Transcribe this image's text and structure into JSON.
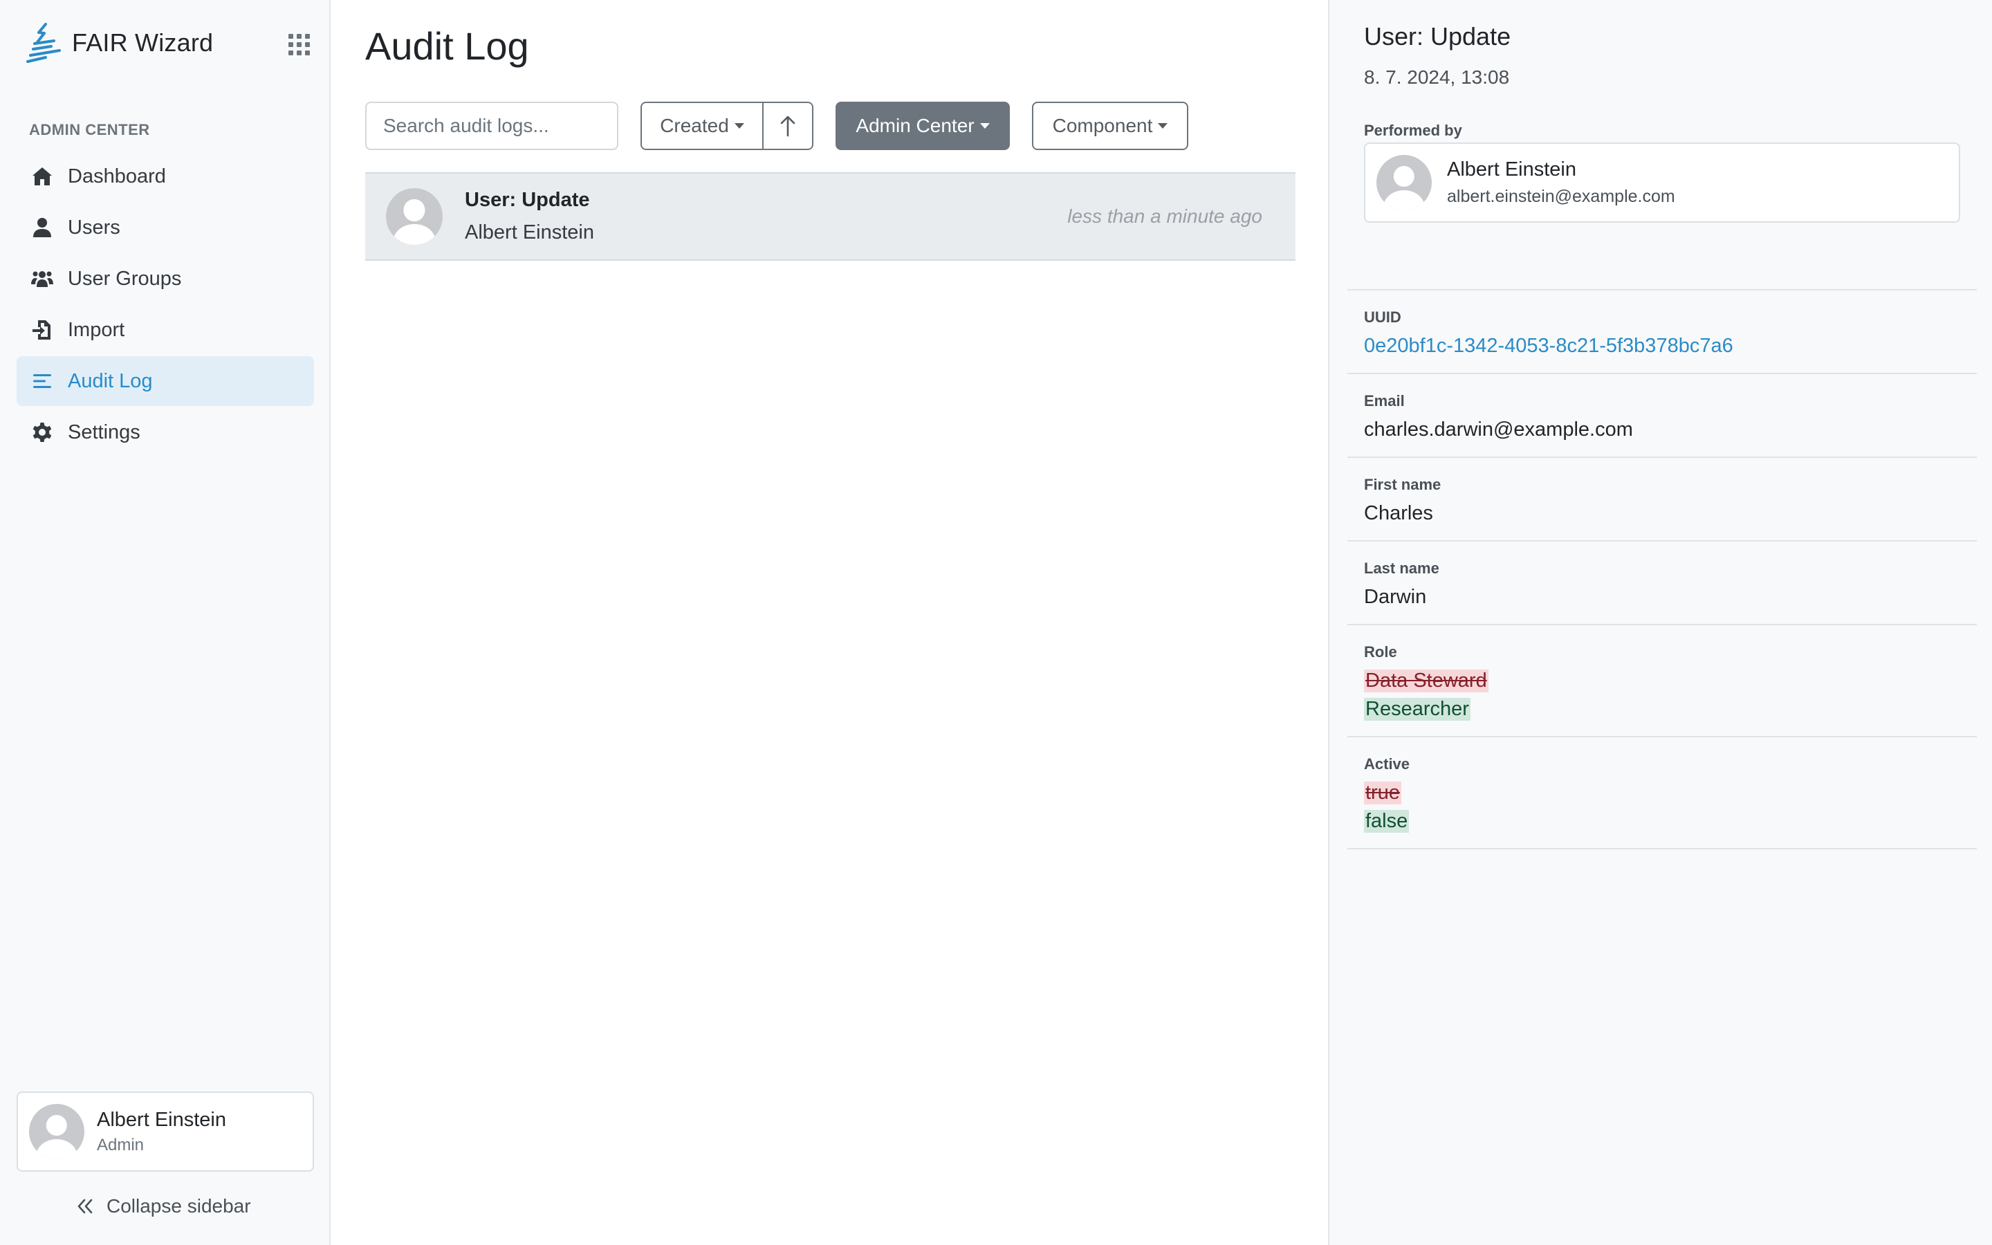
{
  "app": {
    "name": "FAIR Wizard",
    "accent": "#2a8bc7"
  },
  "sidebar": {
    "section_title": "ADMIN CENTER",
    "items": [
      {
        "label": "Dashboard",
        "icon": "home-icon"
      },
      {
        "label": "Users",
        "icon": "user-icon"
      },
      {
        "label": "User Groups",
        "icon": "users-icon"
      },
      {
        "label": "Import",
        "icon": "file-import-icon"
      },
      {
        "label": "Audit Log",
        "icon": "list-icon",
        "active": true
      },
      {
        "label": "Settings",
        "icon": "gear-icon"
      }
    ],
    "profile": {
      "name": "Albert Einstein",
      "role": "Admin"
    },
    "collapse_label": "Collapse sidebar"
  },
  "main": {
    "title": "Audit Log",
    "search": {
      "placeholder": "Search audit logs...",
      "value": ""
    },
    "sort": {
      "label": "Created",
      "direction": "ascending"
    },
    "filters": {
      "admin_center": "Admin Center",
      "component": "Component"
    },
    "entries": [
      {
        "action": "User: Update",
        "user": "Albert Einstein",
        "time": "less than a minute ago"
      }
    ]
  },
  "detail": {
    "title": "User: Update",
    "date": "8. 7. 2024, 13:08",
    "performed_by_label": "Performed by",
    "performer": {
      "name": "Albert Einstein",
      "email": "albert.einstein@example.com"
    },
    "fields": {
      "uuid": {
        "label": "UUID",
        "value": "0e20bf1c-1342-4053-8c21-5f3b378bc7a6"
      },
      "email": {
        "label": "Email",
        "value": "charles.darwin@example.com"
      },
      "first_name": {
        "label": "First name",
        "value": "Charles"
      },
      "last_name": {
        "label": "Last name",
        "value": "Darwin"
      },
      "role": {
        "label": "Role",
        "old": "Data Steward",
        "new": "Researcher"
      },
      "active": {
        "label": "Active",
        "old": "true",
        "new": "false"
      }
    }
  }
}
